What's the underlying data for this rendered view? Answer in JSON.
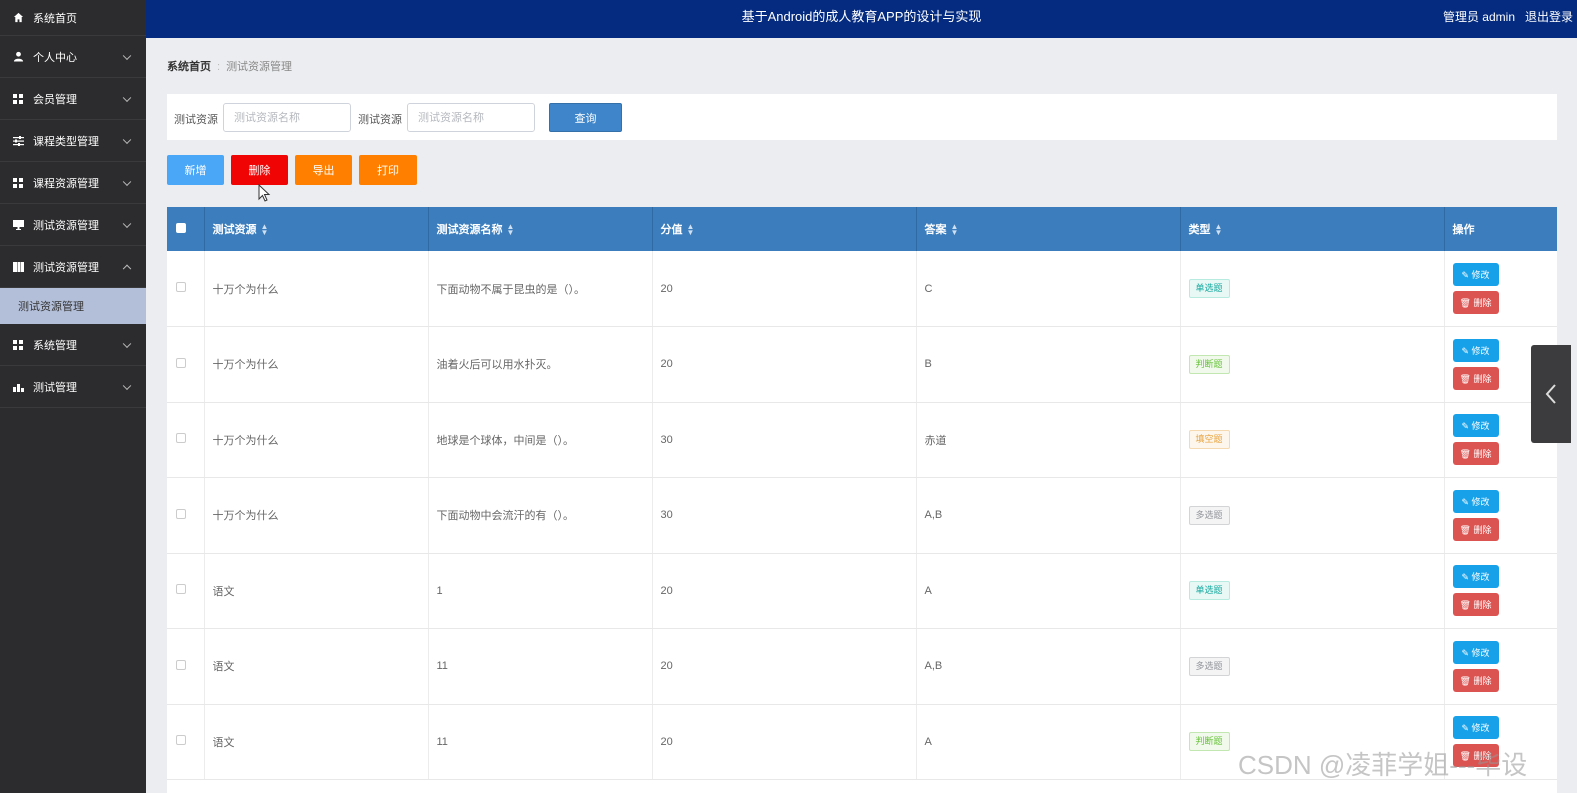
{
  "header": {
    "title": "基于Android的成人教育APP的设计与实现",
    "user": "管理员 admin",
    "logout": "退出登录"
  },
  "sidebar": {
    "items": [
      {
        "label": "系统首页",
        "icon": "home-icon"
      },
      {
        "label": "个人中心",
        "icon": "user-icon"
      },
      {
        "label": "会员管理",
        "icon": "grid-icon"
      },
      {
        "label": "课程类型管理",
        "icon": "sliders-icon"
      },
      {
        "label": "课程资源管理",
        "icon": "grid-icon"
      },
      {
        "label": "测试资源管理",
        "icon": "monitor-icon"
      },
      {
        "label": "测试资源管理",
        "icon": "book-icon",
        "expanded": true
      },
      {
        "label": "系统管理",
        "icon": "grid-icon"
      },
      {
        "label": "测试管理",
        "icon": "chart-icon"
      }
    ],
    "subitem": "测试资源管理"
  },
  "breadcrumb": {
    "home": "系统首页",
    "separator": ":",
    "current": "测试资源管理"
  },
  "search": {
    "label1": "测试资源",
    "placeholder1": "测试资源名称",
    "label2": "测试资源",
    "placeholder2": "测试资源名称",
    "button": "查询"
  },
  "actions": {
    "add": "新增",
    "delete": "删除",
    "export": "导出",
    "print": "打印"
  },
  "table": {
    "headers": [
      "测试资源",
      "测试资源名称",
      "分值",
      "答案",
      "类型",
      "操作"
    ],
    "edit_label": "修改",
    "delete_label": "删除",
    "rows": [
      {
        "resource": "十万个为什么",
        "name": "下面动物不属于昆虫的是（）。",
        "score": "20",
        "answer": "C",
        "type": "单选题"
      },
      {
        "resource": "十万个为什么",
        "name": "油着火后可以用水扑灭。",
        "score": "20",
        "answer": "B",
        "type": "判断题"
      },
      {
        "resource": "十万个为什么",
        "name": "地球是个球体，中间是（）。",
        "score": "30",
        "answer": "赤道",
        "type": "填空题"
      },
      {
        "resource": "十万个为什么",
        "name": "下面动物中会流汗的有（）。",
        "score": "30",
        "answer": "A,B",
        "type": "多选题"
      },
      {
        "resource": "语文",
        "name": "1",
        "score": "20",
        "answer": "A",
        "type": "单选题"
      },
      {
        "resource": "语文",
        "name": "11",
        "score": "20",
        "answer": "A,B",
        "type": "多选题"
      },
      {
        "resource": "语文",
        "name": "11",
        "score": "20",
        "answer": "A",
        "type": "判断题"
      }
    ]
  },
  "colors": {
    "header_bg": "#042b7f",
    "sidebar_bg": "#2c2c2e",
    "table_header_bg": "#3b7dbd",
    "add_btn": "#4aa6f7",
    "delete_btn": "#f10404",
    "export_btn": "#ff8000",
    "print_btn": "#ff8000"
  },
  "watermark": "CSDN @凌菲学姐---毕设"
}
